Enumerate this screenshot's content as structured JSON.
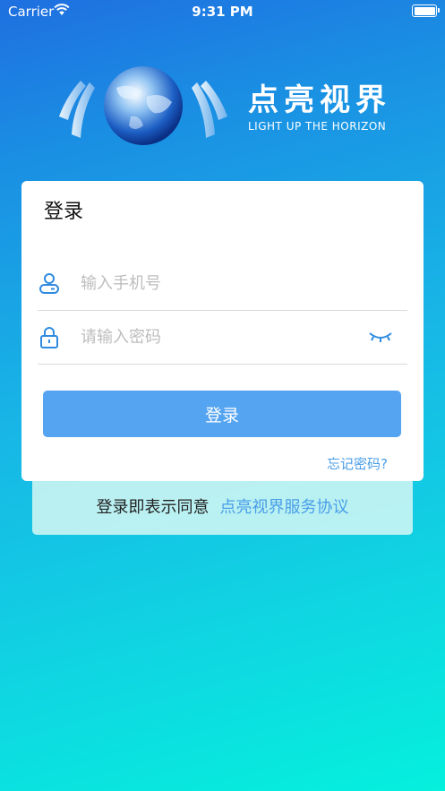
{
  "status_bar": {
    "carrier": "Carrier",
    "time": "9:31 PM"
  },
  "brand": {
    "name_cn": "点亮视界",
    "name_en": "LIGHT UP THE HORIZON"
  },
  "login_card": {
    "title": "登录",
    "phone_placeholder": "输入手机号",
    "password_placeholder": "请输入密码",
    "login_button": "登录",
    "forgot_password": "忘记密码?"
  },
  "agreement": {
    "prefix": "登录即表示同意",
    "link": "点亮视界服务协议"
  },
  "colors": {
    "primary_button": "#55a4f2",
    "link": "#4a9ee8",
    "icon": "#2f8be0"
  }
}
